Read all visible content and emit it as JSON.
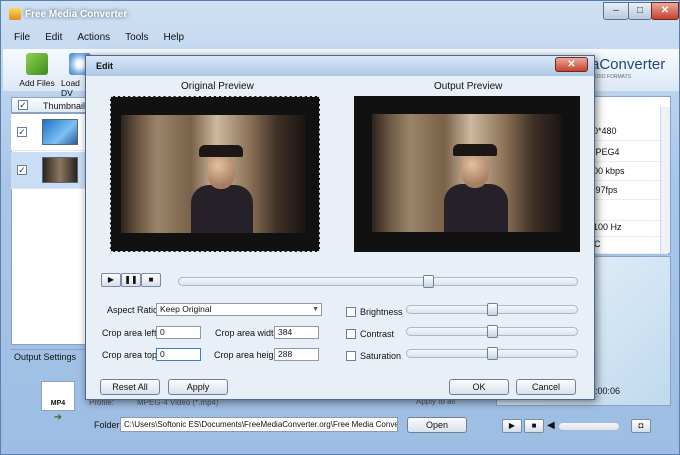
{
  "app": {
    "title": "Free Media Converter"
  },
  "window_controls": {
    "minimize": "–",
    "maximize": "□",
    "close": "✕"
  },
  "menu": [
    "File",
    "Edit",
    "Actions",
    "Tools",
    "Help"
  ],
  "toolbar": {
    "add_files": "Add Files",
    "load_dvd": "Load DV"
  },
  "brand": {
    "name": "aConverter",
    "tagline": "UDIO FORMATS"
  },
  "file_list": {
    "header_thumbnail": "Thumbnail",
    "rows": [
      {
        "checked": "✓"
      },
      {
        "checked": "✓"
      }
    ]
  },
  "properties": [
    "40*480",
    "MPEG4",
    "200 kbps",
    "9.97fps",
    "",
    "4100 Hz",
    "AC"
  ],
  "output_settings": {
    "title": "Output Settings",
    "profile_label": "Profile:",
    "profile_value": "MPEG-4 Video (*.mp4)",
    "apply_all": "Apply to all",
    "format_badge": "MP4",
    "folder_label": "Folder:",
    "folder_value": "C:\\Users\\Softonic ES\\Documents\\FreeMediaConverter.org\\Free Media Convert",
    "open_button": "Open"
  },
  "player": {
    "time": "0:00:06"
  },
  "dialog": {
    "title": "Edit",
    "original_preview": "Original Preview",
    "output_preview": "Output Preview",
    "aspect_ratio_label": "Aspect Ratio:",
    "aspect_ratio_value": "Keep Original",
    "crop_left_label": "Crop area left:",
    "crop_left": "0",
    "crop_top_label": "Crop area top:",
    "crop_top": "0",
    "crop_width_label": "Crop area width:",
    "crop_width": "384",
    "crop_height_label": "Crop area height:",
    "crop_height": "288",
    "brightness_label": "Brightness",
    "contrast_label": "Contrast",
    "saturation_label": "Saturation",
    "reset_all": "Reset All",
    "apply": "Apply",
    "ok": "OK",
    "cancel": "Cancel",
    "close": "✕",
    "seek_position": 0.63,
    "brightness_level": 0.5,
    "contrast_level": 0.5,
    "saturation_level": 0.5
  },
  "colors": {
    "accent": "#3a6ea5",
    "selection": "#c9ddf4",
    "close_red": "#c7422c"
  }
}
